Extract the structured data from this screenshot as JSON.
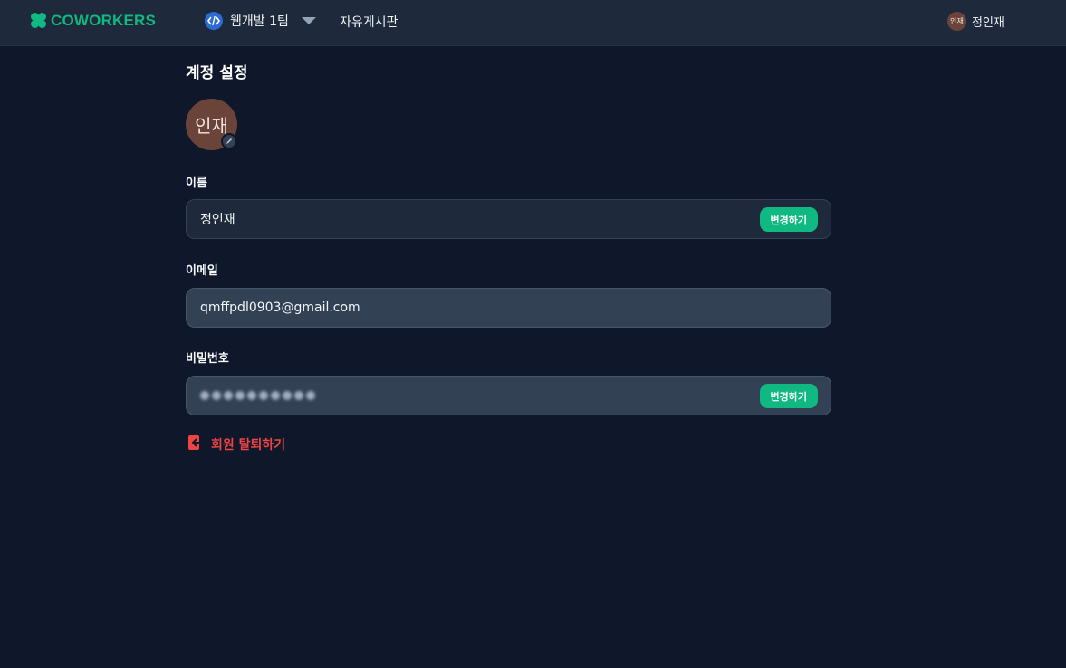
{
  "header": {
    "logo_text": "COWORKERS",
    "team_name": "웹개발 1팀",
    "board_link": "자유게시판",
    "profile_avatar_text": "인재",
    "profile_name": "정인재"
  },
  "main": {
    "title": "계정 설정",
    "avatar_text": "인재",
    "name": {
      "label": "이름",
      "value": "정인재",
      "button": "변경하기"
    },
    "email": {
      "label": "이메일",
      "value": "qmffpdl0903@gmail.com"
    },
    "password": {
      "label": "비밀번호",
      "masked_length": 10,
      "button": "변경하기"
    },
    "withdraw": "회원 탈퇴하기"
  },
  "colors": {
    "accent": "#10b981",
    "danger": "#ef4444",
    "background": "#0f172a",
    "surface": "#1e293b",
    "avatar": "#6b4439"
  },
  "icons": [
    "logo-icon",
    "code-icon",
    "chevron-down-icon",
    "pencil-icon",
    "logout-icon"
  ]
}
